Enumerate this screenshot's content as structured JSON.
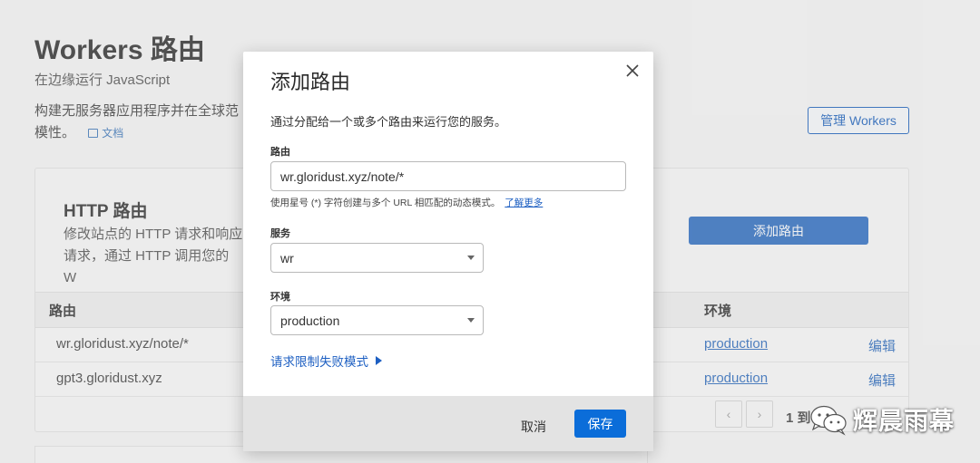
{
  "background": {
    "title": "Workers 路由",
    "subtitle": "在边缘运行 JavaScript",
    "description": "构建无服务器应用程序并在全球范 模性。",
    "doc_link": "文档",
    "manage_button": "管理 Workers",
    "http_card": {
      "title": "HTTP 路由",
      "description": "修改站点的 HTTP 请求和响应 请求，通过 HTTP 调用您的 W",
      "add_button": "添加路由"
    },
    "table": {
      "col_route": "路由",
      "col_env": "环境",
      "rows": [
        {
          "route": "wr.gloridust.xyz/note/*",
          "env": "production",
          "edit": "编辑"
        },
        {
          "route": "gpt3.gloridust.xyz",
          "env": "production",
          "edit": "编辑"
        }
      ]
    },
    "pager": {
      "prev": "‹",
      "next": "›",
      "text": "1 到"
    }
  },
  "modal": {
    "title": "添加路由",
    "intro": "通过分配给一个或多个路由来运行您的服务。",
    "route_label": "路由",
    "route_value": "wr.gloridust.xyz/note/*",
    "helper_text": "使用星号 (*) 字符创建与多个 URL 相匹配的动态模式。",
    "helper_link": "了解更多",
    "service_label": "服务",
    "service_value": "wr",
    "env_label": "环境",
    "env_value": "production",
    "failure_mode": "请求限制失败模式",
    "cancel": "取消",
    "save": "保存"
  },
  "watermark": {
    "text": "辉晨雨幕"
  },
  "colors": {
    "primary": "#0b6dd9",
    "link": "#1d5fc2",
    "dark_blue": "#0a55b8"
  }
}
